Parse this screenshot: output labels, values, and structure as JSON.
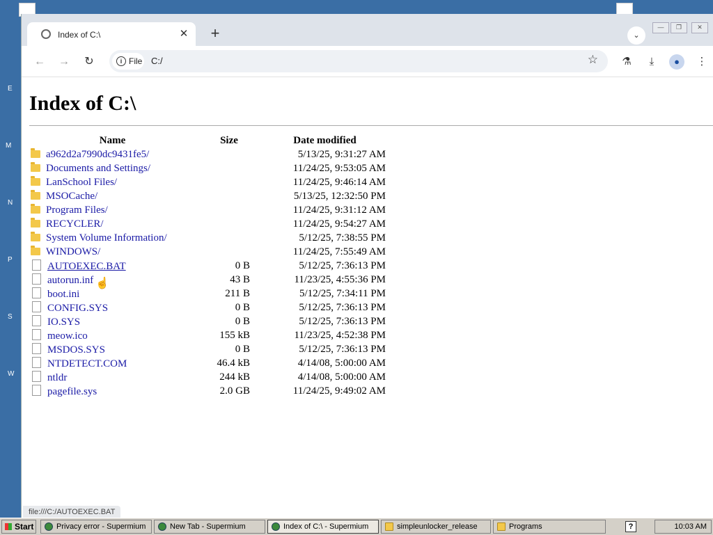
{
  "desktop": {
    "side_labels": [
      "E",
      "M",
      "N",
      "P",
      "S",
      "W"
    ]
  },
  "browser": {
    "tab": {
      "title": "Index of C:\\",
      "close_glyph": "✕"
    },
    "new_tab_glyph": "+",
    "address": {
      "chip_label": "File",
      "url": "C:/"
    },
    "status_url": "file:///C:/AUTOEXEC.BAT"
  },
  "page": {
    "heading": "Index of C:\\",
    "columns": {
      "name": "Name",
      "size": "Size",
      "date": "Date modified"
    },
    "rows": [
      {
        "type": "folder",
        "name": "a962d2a7990dc9431fe5/",
        "size": "",
        "date": "5/13/25, 9:31:27 AM"
      },
      {
        "type": "folder",
        "name": "Documents and Settings/",
        "size": "",
        "date": "11/24/25, 9:53:05 AM"
      },
      {
        "type": "folder",
        "name": "LanSchool Files/",
        "size": "",
        "date": "11/24/25, 9:46:14 AM"
      },
      {
        "type": "folder",
        "name": "MSOCache/",
        "size": "",
        "date": "5/13/25, 12:32:50 PM"
      },
      {
        "type": "folder",
        "name": "Program Files/",
        "size": "",
        "date": "11/24/25, 9:31:12 AM"
      },
      {
        "type": "folder",
        "name": "RECYCLER/",
        "size": "",
        "date": "11/24/25, 9:54:27 AM"
      },
      {
        "type": "folder",
        "name": "System Volume Information/",
        "size": "",
        "date": "5/12/25, 7:38:55 PM"
      },
      {
        "type": "folder",
        "name": "WINDOWS/",
        "size": "",
        "date": "11/24/25, 7:55:49 AM"
      },
      {
        "type": "file",
        "name": "AUTOEXEC.BAT",
        "size": "0 B",
        "date": "5/12/25, 7:36:13 PM"
      },
      {
        "type": "file",
        "name": "autorun.inf",
        "size": "43 B",
        "date": "11/23/25, 4:55:36 PM"
      },
      {
        "type": "file",
        "name": "boot.ini",
        "size": "211 B",
        "date": "5/12/25, 7:34:11 PM"
      },
      {
        "type": "file",
        "name": "CONFIG.SYS",
        "size": "0 B",
        "date": "5/12/25, 7:36:13 PM"
      },
      {
        "type": "file",
        "name": "IO.SYS",
        "size": "0 B",
        "date": "5/12/25, 7:36:13 PM"
      },
      {
        "type": "file",
        "name": "meow.ico",
        "size": "155 kB",
        "date": "11/23/25, 4:52:38 PM"
      },
      {
        "type": "file",
        "name": "MSDOS.SYS",
        "size": "0 B",
        "date": "5/12/25, 7:36:13 PM"
      },
      {
        "type": "file",
        "name": "NTDETECT.COM",
        "size": "46.4 kB",
        "date": "4/14/08, 5:00:00 AM"
      },
      {
        "type": "file",
        "name": "ntldr",
        "size": "244 kB",
        "date": "4/14/08, 5:00:00 AM"
      },
      {
        "type": "file",
        "name": "pagefile.sys",
        "size": "2.0 GB",
        "date": "11/24/25, 9:49:02 AM"
      }
    ]
  },
  "taskbar": {
    "start_label": "Start",
    "tasks": [
      {
        "label": "Privacy error - Supermium",
        "icon": "browser-icon"
      },
      {
        "label": "New Tab - Supermium",
        "icon": "browser-icon"
      },
      {
        "label": "Index of C:\\ - Supermium",
        "icon": "browser-icon"
      },
      {
        "label": "simpleunlocker_release",
        "icon": "folder-icon"
      },
      {
        "label": "Programs",
        "icon": "folder-icon"
      }
    ],
    "help_glyph": "?",
    "clock": "10:03 AM"
  },
  "colors": {
    "link": "#1a1aa6",
    "desktop": "#3a6ea5",
    "folder": "#f3c84a"
  }
}
